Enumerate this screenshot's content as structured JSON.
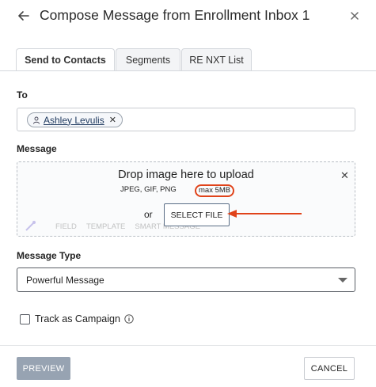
{
  "header": {
    "title": "Compose Message from Enrollment Inbox 1",
    "back_icon": "arrow-left-icon",
    "close_icon": "close-icon"
  },
  "tabs": [
    {
      "label": "Send to Contacts",
      "active": true
    },
    {
      "label": "Segments",
      "active": false
    },
    {
      "label": "RE NXT List",
      "active": false
    }
  ],
  "to": {
    "label": "To",
    "recipients": [
      {
        "name": "Ashley Levulis",
        "icon": "person-icon"
      }
    ]
  },
  "message": {
    "label": "Message",
    "drop_title": "Drop image here to upload",
    "drop_types": "JPEG, GIF, PNG",
    "drop_max": "max 5MB",
    "or_text": "or",
    "select_file": "SELECT FILE",
    "toolbar": [
      "FIELD",
      "TEMPLATE",
      "SMART MESSAGE"
    ],
    "annotation_color": "#e0431a"
  },
  "message_type": {
    "label": "Message Type",
    "value": "Powerful Message"
  },
  "track": {
    "label": "Track as Campaign",
    "checked": false
  },
  "footer": {
    "preview": "PREVIEW",
    "cancel": "CANCEL"
  }
}
